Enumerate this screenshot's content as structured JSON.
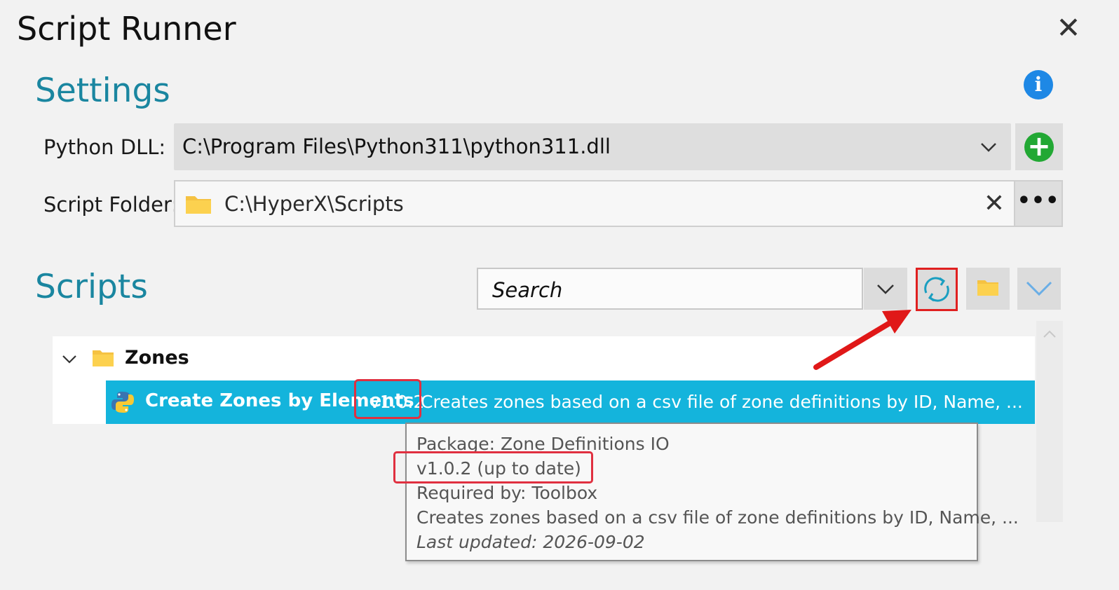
{
  "window": {
    "title": "Script Runner",
    "close_glyph": "✕"
  },
  "settings": {
    "heading": "Settings",
    "info_glyph": "i",
    "python_dll_label": "Python DLL:",
    "python_dll_value": "C:\\Program Files\\Python311\\python311.dll",
    "add_glyph": "+",
    "script_folder_label": "Script Folder:",
    "script_folder_value": "C:\\HyperX\\Scripts",
    "clear_glyph": "✕",
    "browse_glyph": "•••"
  },
  "scripts": {
    "heading": "Scripts",
    "search_placeholder": "Search",
    "toolbar_icons": [
      "chevron-down-icon",
      "refresh-icon",
      "folder-icon",
      "collapse-chevron-icon"
    ],
    "tree": {
      "group_label": "Zones",
      "items": [
        {
          "name": "Create Zones by Elements",
          "version": "v1.0.2",
          "description": "Creates zones based on a csv file of zone definitions by ID, Name, ..."
        }
      ]
    },
    "tooltip": {
      "package": "Package: Zone Definitions IO",
      "version_status": "v1.0.2  (up to date)",
      "required_by": "Required by: Toolbox",
      "description": "Creates zones based on a csv file of zone definitions by ID, Name, ...",
      "last_updated": "Last updated:  2026-09-02"
    }
  },
  "colors": {
    "accent": "#1a86a0",
    "selection": "#14b4dc",
    "highlight": "#e03040",
    "add_green": "#22a834",
    "info_blue": "#1e88e5"
  }
}
